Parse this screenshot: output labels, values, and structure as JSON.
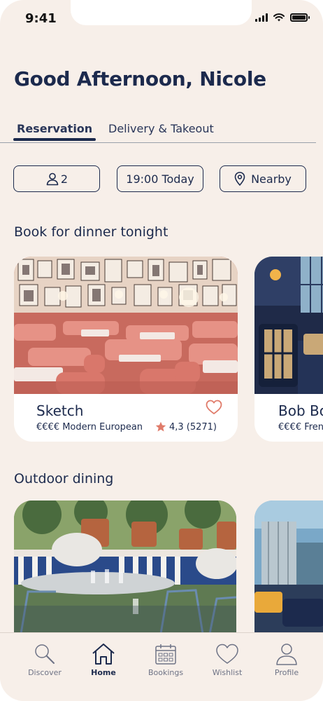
{
  "status_bar": {
    "time": "9:41"
  },
  "greeting": "Good Afternoon, Nicole",
  "tabs": [
    {
      "label": "Reservation",
      "active": true
    },
    {
      "label": "Delivery & Takeout",
      "active": false
    }
  ],
  "filters": {
    "guests": "2",
    "time": "19:00 Today",
    "location": "Nearby"
  },
  "sections": {
    "dinner_title": "Book for dinner tonight",
    "outdoor_title": "Outdoor dining"
  },
  "restaurants": [
    {
      "name": "Sketch",
      "meta": "€€€€ Modern European",
      "rating": "4,3 (5271)"
    },
    {
      "name": "Bob Bo",
      "meta": "€€€€ Fren"
    }
  ],
  "bottom_nav": [
    {
      "label": "Discover",
      "icon": "search-icon"
    },
    {
      "label": "Home",
      "icon": "home-icon",
      "active": true
    },
    {
      "label": "Bookings",
      "icon": "calendar-icon"
    },
    {
      "label": "Wishlist",
      "icon": "heart-icon"
    },
    {
      "label": "Profile",
      "icon": "user-icon"
    }
  ],
  "colors": {
    "background": "#f7efe9",
    "primary": "#1c2a4d",
    "accent": "#e07b6a",
    "star": "#e07b6a"
  }
}
